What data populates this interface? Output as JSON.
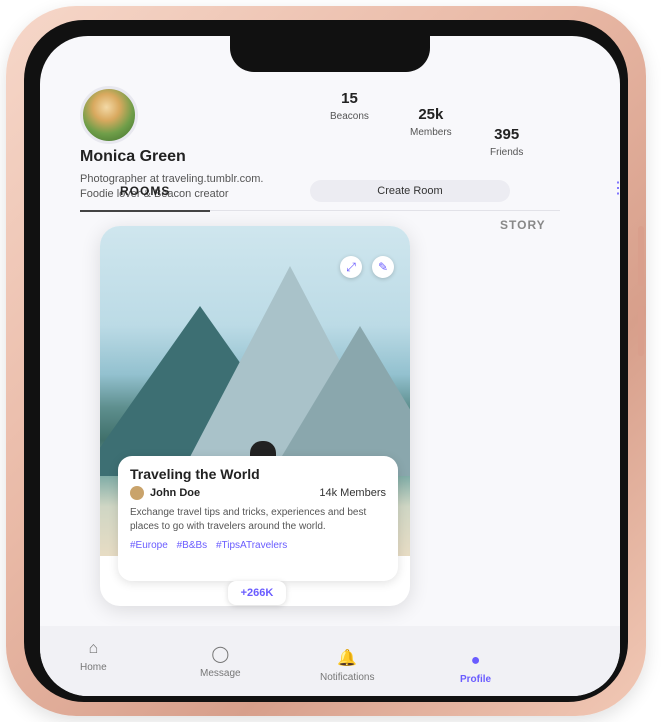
{
  "profile": {
    "name": "Monica Green",
    "bio": "Photographer at traveling.tumblr.com. Foodie lover & Beacon creator",
    "stats": [
      {
        "value": "15",
        "label": "Beacons"
      },
      {
        "value": "25k",
        "label": "Members"
      },
      {
        "value": "395",
        "label": "Friends"
      }
    ],
    "create_room": "Create Room",
    "more_icon": "⋮"
  },
  "tabs": {
    "rooms": "ROOMS",
    "story": "STORY"
  },
  "card": {
    "title": "Traveling the World",
    "author": "John Doe",
    "members": "14k Members",
    "description": "Exchange travel tips and tricks, experiences and best places to go with travelers around the world.",
    "tags": [
      "#Europe",
      "#B&Bs",
      "#TipsATravelers"
    ],
    "count": "+266K",
    "share_icon": "share-icon",
    "edit_icon": "edit-icon"
  },
  "nav": [
    {
      "label": "Home",
      "icon": "⌂"
    },
    {
      "label": "Message",
      "icon": "◯"
    },
    {
      "label": "Notifications",
      "icon": "🔔"
    },
    {
      "label": "Profile",
      "icon": "●"
    }
  ],
  "colors": {
    "accent": "#6a5cff"
  }
}
